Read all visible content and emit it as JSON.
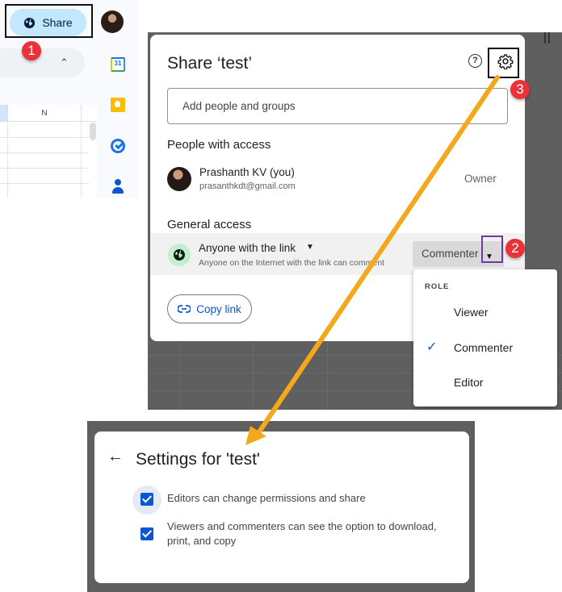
{
  "sheets": {
    "share_button_label": "Share",
    "column_header": "N",
    "side_apps": [
      "calendar-icon",
      "keep-icon",
      "tasks-icon",
      "contacts-icon"
    ],
    "calendar_day": "31"
  },
  "annotations": {
    "step1": "1",
    "step2": "2",
    "step3": "3",
    "arrow_color": "#f4a81c",
    "badge_color": "#e8333a"
  },
  "share_dialog": {
    "title": "Share ‘test’",
    "help_icon": "?",
    "add_people_placeholder": "Add people and groups",
    "people_with_access_heading": "People with access",
    "person": {
      "name": "Prashanth KV (you)",
      "email": "prasanthkdt@gmail.com",
      "role": "Owner"
    },
    "general_access_heading": "General access",
    "general_access": {
      "title": "Anyone with the link",
      "subtitle": "Anyone on the Internet with the link can comment",
      "role": "Commenter"
    },
    "copy_link_label": "Copy link"
  },
  "role_menu": {
    "label": "ROLE",
    "items": [
      {
        "label": "Viewer",
        "checked": false
      },
      {
        "label": "Commenter",
        "checked": true
      },
      {
        "label": "Editor",
        "checked": false
      }
    ],
    "check_glyph": "✓"
  },
  "settings": {
    "back_glyph": "←",
    "title": "Settings for 'test'",
    "options": [
      {
        "label": "Editors can change permissions and share",
        "checked": true
      },
      {
        "label": "Viewers and commenters can see the option to download, print, and copy",
        "checked": true
      }
    ]
  }
}
